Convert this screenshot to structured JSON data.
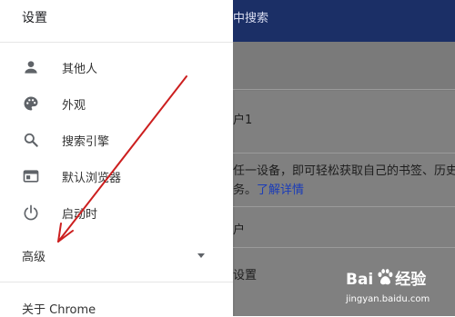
{
  "background": {
    "search_text": "中搜索",
    "user_label": "户1",
    "sync_text_1": "任一设备，即可轻松获取自己的书签、历史",
    "sync_text_2": "务。",
    "learn_more": "了解详情",
    "people_label": "户",
    "settings_label": "设置"
  },
  "drawer": {
    "title": "设置",
    "items": [
      {
        "label": "其他人",
        "icon": "person-icon"
      },
      {
        "label": "外观",
        "icon": "palette-icon"
      },
      {
        "label": "搜索引擎",
        "icon": "search-icon"
      },
      {
        "label": "默认浏览器",
        "icon": "browser-icon"
      },
      {
        "label": "启动时",
        "icon": "power-icon"
      }
    ],
    "advanced": "高级",
    "about": "关于 Chrome"
  },
  "watermark": {
    "logo": "Bai",
    "logo_suffix": "经验",
    "url": "jingyan.baidu.com"
  },
  "colors": {
    "header": "#1b2f66",
    "annotation_arrow": "#cc1f1f"
  }
}
